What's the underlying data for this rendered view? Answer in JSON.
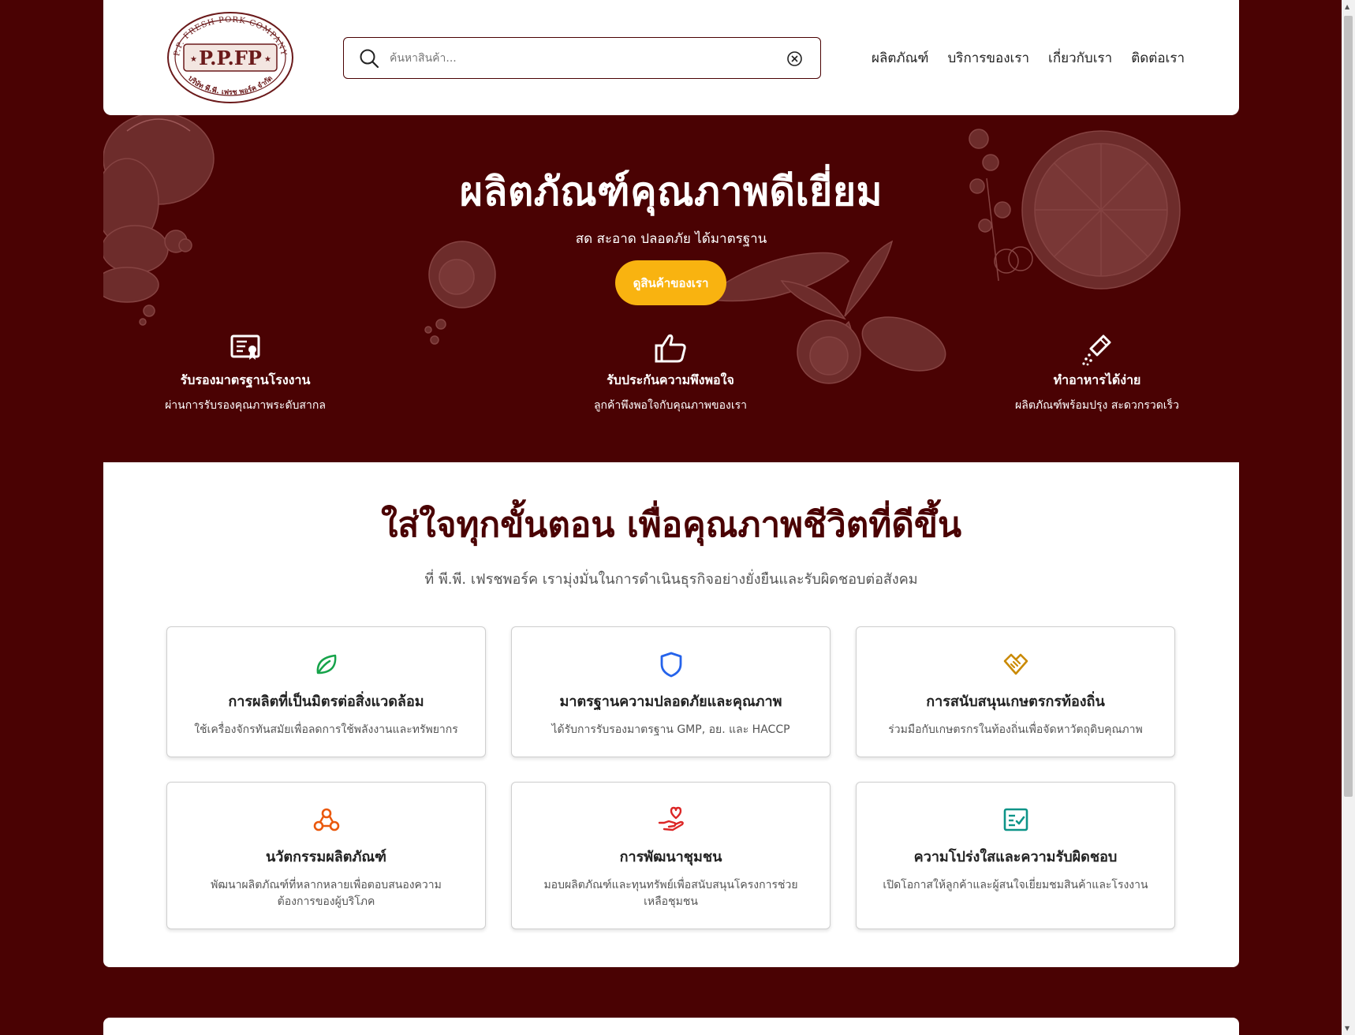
{
  "header": {
    "logo": {
      "ring_text": "P.P. FRESH PORK COMPANY",
      "brand": "P.P.FP",
      "thai_name": "บริษัท พี.พี. เฟรช พอร์ค จำกัด"
    },
    "search": {
      "placeholder": "ค้นหาสินค้า...",
      "value": ""
    },
    "nav": [
      "ผลิตภัณฑ์",
      "บริการของเรา",
      "เกี่ยวกับเรา",
      "ติดต่อเรา"
    ]
  },
  "hero": {
    "title": "ผลิตภัณฑ์คุณภาพดีเยี่ยม",
    "subtitle": "สด สะอาด ปลอดภัย ได้มาตรฐาน",
    "cta": "ดูสินค้าของเรา",
    "features": [
      {
        "icon": "certificate-icon",
        "title": "รับรองมาตรฐานโรงงาน",
        "desc": "ผ่านการรับรองคุณภาพระดับสากล"
      },
      {
        "icon": "thumbs-up-icon",
        "title": "รับประกันความพึงพอใจ",
        "desc": "ลูกค้าพึงพอใจกับคุณภาพของเรา"
      },
      {
        "icon": "seasoning-icon",
        "title": "ทำอาหารได้ง่าย",
        "desc": "ผลิตภัณฑ์พร้อมปรุง สะดวกรวดเร็ว"
      }
    ]
  },
  "commitment": {
    "title": "ใส่ใจทุกขั้นตอน เพื่อคุณภาพชีวิตที่ดีขึ้น",
    "subtitle": "ที่ พี.พี. เฟรชพอร์ค เรามุ่งมั่นในการดำเนินธุรกิจอย่างยั่งยืนและรับผิดชอบต่อสังคม",
    "cards": [
      {
        "icon": "leaf-icon",
        "color": "#16a34a",
        "title": "การผลิตที่เป็นมิตรต่อสิ่งแวดล้อม",
        "desc": "ใช้เครื่องจักรทันสมัยเพื่อลดการใช้พลังงานและทรัพยากร"
      },
      {
        "icon": "shield-icon",
        "color": "#2563eb",
        "title": "มาตรฐานความปลอดภัยและคุณภาพ",
        "desc": "ได้รับการรับรองมาตรฐาน GMP, อย. และ HACCP"
      },
      {
        "icon": "handshake-icon",
        "color": "#ca8a04",
        "title": "การสนับสนุนเกษตรกรท้องถิ่น",
        "desc": "ร่วมมือกับเกษตรกรในท้องถิ่นเพื่อจัดหาวัตถุดิบคุณภาพ"
      },
      {
        "icon": "innovation-icon",
        "color": "#ea580c",
        "title": "นวัตกรรมผลิตภัณฑ์",
        "desc": "พัฒนาผลิตภัณฑ์ที่หลากหลายเพื่อตอบสนองความต้องการของผู้บริโภค"
      },
      {
        "icon": "heart-hand-icon",
        "color": "#dc2626",
        "title": "การพัฒนาชุมชน",
        "desc": "มอบผลิตภัณฑ์และทุนทรัพย์เพื่อสนับสนุนโครงการช่วยเหลือชุมชน"
      },
      {
        "icon": "checklist-icon",
        "color": "#0d9488",
        "title": "ความโปร่งใสและความรับผิดชอบ",
        "desc": "เปิดโอกาสให้ลูกค้าและผู้สนใจเยี่ยมชมสินค้าและโรงงาน"
      }
    ]
  },
  "colors": {
    "brand_dark": "#4a0203",
    "accent": "#f9b310"
  }
}
